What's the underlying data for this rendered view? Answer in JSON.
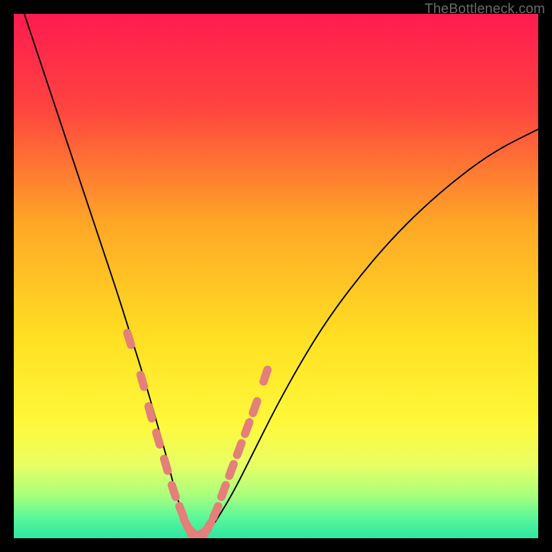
{
  "watermark": "TheBottleneck.com",
  "chart_data": {
    "type": "line",
    "title": "",
    "xlabel": "",
    "ylabel": "",
    "xlim": [
      0,
      100
    ],
    "ylim": [
      0,
      100
    ],
    "grid": false,
    "legend": false,
    "background_gradient_stops": [
      {
        "offset": 0.0,
        "color": "#ff1b50"
      },
      {
        "offset": 0.18,
        "color": "#ff4440"
      },
      {
        "offset": 0.4,
        "color": "#ffa726"
      },
      {
        "offset": 0.62,
        "color": "#ffe023"
      },
      {
        "offset": 0.78,
        "color": "#fff83a"
      },
      {
        "offset": 0.86,
        "color": "#e8ff63"
      },
      {
        "offset": 0.92,
        "color": "#a7ff7e"
      },
      {
        "offset": 0.96,
        "color": "#5cf79b"
      },
      {
        "offset": 1.0,
        "color": "#2ce8a0"
      }
    ],
    "series": [
      {
        "name": "bottleneck-curve",
        "stroke": "#000000",
        "x": [
          2,
          5,
          8,
          11,
          14,
          17,
          20,
          22.5,
          25,
          27,
          29,
          30.5,
          32,
          33.5,
          35,
          37,
          39,
          42,
          46,
          50,
          55,
          60,
          66,
          72,
          78,
          85,
          92,
          100
        ],
        "y": [
          100,
          91,
          82,
          73,
          64,
          55,
          46,
          38,
          30,
          23,
          16,
          10,
          5,
          2,
          0.5,
          1,
          4,
          9,
          17,
          25,
          34,
          42,
          50,
          57,
          63,
          69,
          74,
          78
        ]
      }
    ],
    "markers": {
      "name": "highlight-dots",
      "color": "#e47f7a",
      "points": [
        {
          "x": 22.0,
          "y": 38
        },
        {
          "x": 24.5,
          "y": 30
        },
        {
          "x": 26.0,
          "y": 24
        },
        {
          "x": 27.5,
          "y": 19
        },
        {
          "x": 29.0,
          "y": 14
        },
        {
          "x": 30.5,
          "y": 9
        },
        {
          "x": 32.0,
          "y": 5
        },
        {
          "x": 33.0,
          "y": 2.5
        },
        {
          "x": 34.0,
          "y": 1.2
        },
        {
          "x": 35.0,
          "y": 0.6
        },
        {
          "x": 36.0,
          "y": 1.0
        },
        {
          "x": 37.0,
          "y": 2.0
        },
        {
          "x": 38.5,
          "y": 5.0
        },
        {
          "x": 40.0,
          "y": 9.0
        },
        {
          "x": 41.5,
          "y": 13
        },
        {
          "x": 43.0,
          "y": 17
        },
        {
          "x": 44.5,
          "y": 21
        },
        {
          "x": 46.0,
          "y": 25
        },
        {
          "x": 48.0,
          "y": 31
        }
      ]
    }
  }
}
